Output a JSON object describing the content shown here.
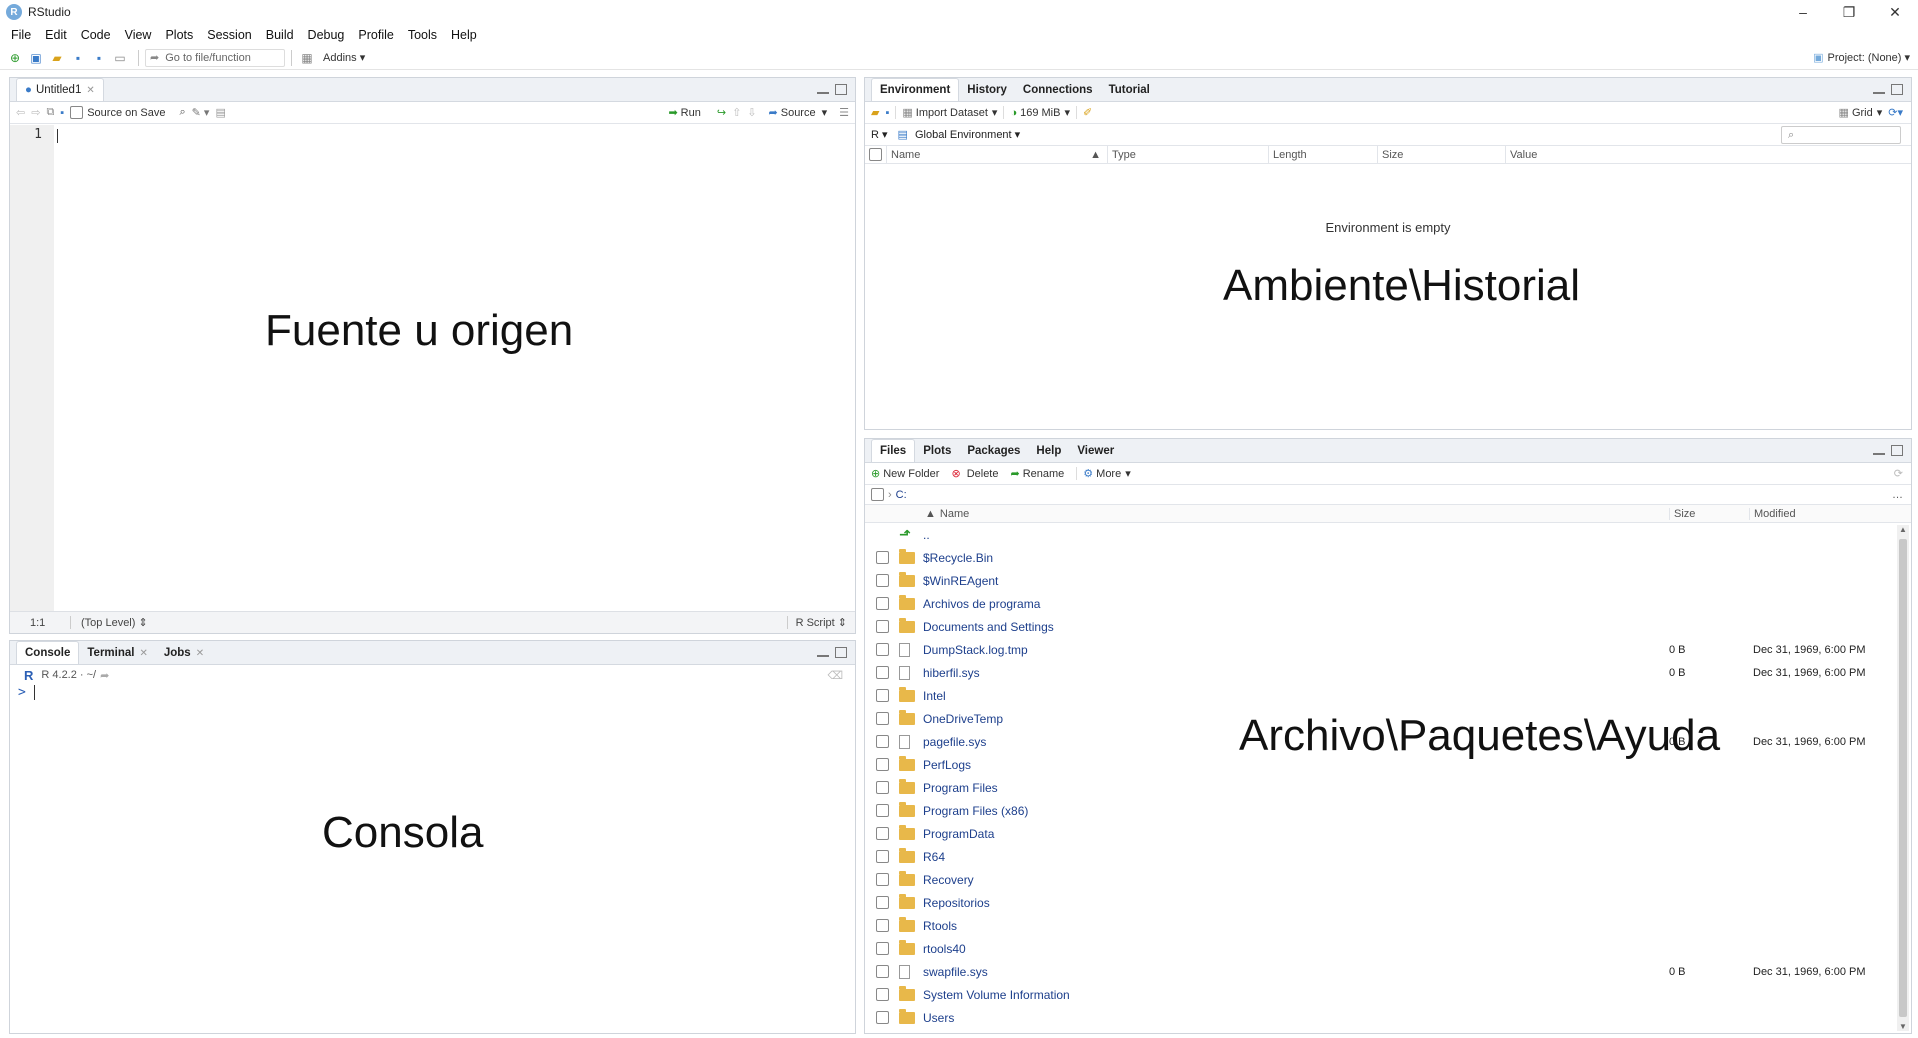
{
  "window": {
    "title": "RStudio",
    "controls": [
      "–",
      "❐",
      "✕"
    ]
  },
  "menu": [
    "File",
    "Edit",
    "Code",
    "View",
    "Plots",
    "Session",
    "Build",
    "Debug",
    "Profile",
    "Tools",
    "Help"
  ],
  "toolbar": {
    "goto_placeholder": "Go to file/function",
    "addins": "Addins",
    "project": "Project: (None)"
  },
  "source": {
    "tab": "Untitled1",
    "source_on_save": "Source on Save",
    "run": "Run",
    "source_btn": "Source",
    "line_number": "1",
    "status_pos": "1:1",
    "status_scope": "(Top Level)",
    "status_type": "R Script",
    "overlay": "Fuente u origen"
  },
  "env": {
    "tabs": [
      "Environment",
      "History",
      "Connections",
      "Tutorial"
    ],
    "import_dataset": "Import Dataset",
    "memory": "169 MiB",
    "r_label": "R",
    "global_env": "Global Environment",
    "grid": "Grid",
    "columns": [
      "Name",
      "Type",
      "Length",
      "Size",
      "Value"
    ],
    "empty": "Environment is empty",
    "overlay": "Ambiente\\Historial"
  },
  "files": {
    "tabs": [
      "Files",
      "Plots",
      "Packages",
      "Help",
      "Viewer"
    ],
    "new_folder": "New Folder",
    "delete": "Delete",
    "rename": "Rename",
    "more": "More",
    "path": "C:",
    "columns": [
      "Name",
      "Size",
      "Modified"
    ],
    "up": "..",
    "rows": [
      {
        "name": "$Recycle.Bin",
        "type": "folder",
        "size": "",
        "modified": ""
      },
      {
        "name": "$WinREAgent",
        "type": "folder",
        "size": "",
        "modified": ""
      },
      {
        "name": "Archivos de programa",
        "type": "folder",
        "size": "",
        "modified": ""
      },
      {
        "name": "Documents and Settings",
        "type": "folder",
        "size": "",
        "modified": ""
      },
      {
        "name": "DumpStack.log.tmp",
        "type": "file",
        "size": "0 B",
        "modified": "Dec 31, 1969, 6:00 PM"
      },
      {
        "name": "hiberfil.sys",
        "type": "file",
        "size": "0 B",
        "modified": "Dec 31, 1969, 6:00 PM"
      },
      {
        "name": "Intel",
        "type": "folder",
        "size": "",
        "modified": ""
      },
      {
        "name": "OneDriveTemp",
        "type": "folder",
        "size": "",
        "modified": ""
      },
      {
        "name": "pagefile.sys",
        "type": "file",
        "size": "0 B",
        "modified": "Dec 31, 1969, 6:00 PM"
      },
      {
        "name": "PerfLogs",
        "type": "folder",
        "size": "",
        "modified": ""
      },
      {
        "name": "Program Files",
        "type": "folder",
        "size": "",
        "modified": ""
      },
      {
        "name": "Program Files (x86)",
        "type": "folder",
        "size": "",
        "modified": ""
      },
      {
        "name": "ProgramData",
        "type": "folder",
        "size": "",
        "modified": ""
      },
      {
        "name": "R64",
        "type": "folder",
        "size": "",
        "modified": ""
      },
      {
        "name": "Recovery",
        "type": "folder",
        "size": "",
        "modified": ""
      },
      {
        "name": "Repositorios",
        "type": "folder",
        "size": "",
        "modified": ""
      },
      {
        "name": "Rtools",
        "type": "folder",
        "size": "",
        "modified": ""
      },
      {
        "name": "rtools40",
        "type": "folder",
        "size": "",
        "modified": ""
      },
      {
        "name": "swapfile.sys",
        "type": "file",
        "size": "0 B",
        "modified": "Dec 31, 1969, 6:00 PM"
      },
      {
        "name": "System Volume Information",
        "type": "folder",
        "size": "",
        "modified": ""
      },
      {
        "name": "Users",
        "type": "folder",
        "size": "",
        "modified": ""
      }
    ],
    "overlay": "Archivo\\Paquetes\\Ayuda"
  },
  "console": {
    "tabs": [
      "Console",
      "Terminal",
      "Jobs"
    ],
    "version": "R 4.2.2 · ~/",
    "prompt": ">",
    "overlay": "Consola"
  }
}
